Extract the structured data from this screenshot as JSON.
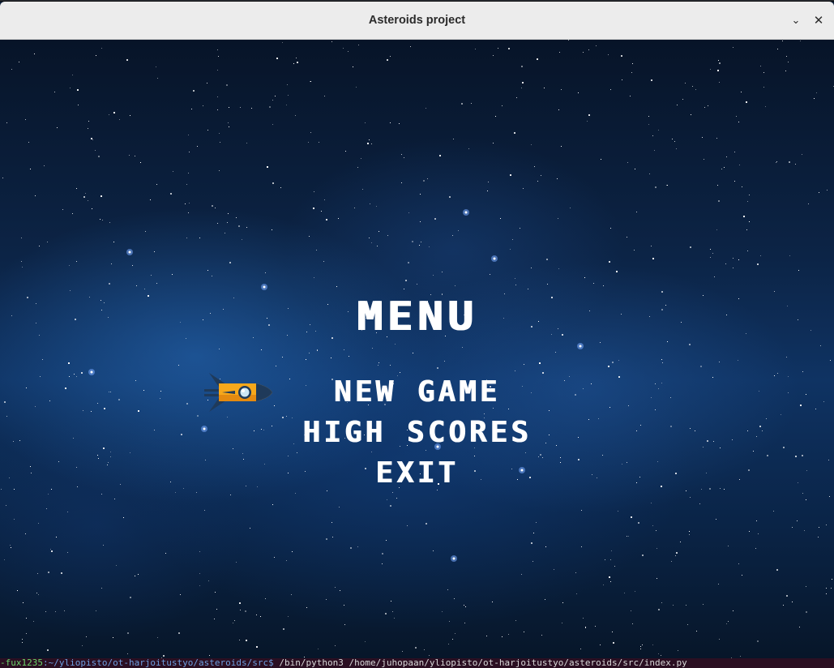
{
  "window": {
    "title": "Asteroids project",
    "minimize_icon": "chevron-down-icon",
    "close_icon": "close-icon"
  },
  "game": {
    "menu_title": "MENU",
    "items": [
      {
        "label": "NEW GAME",
        "selected": true
      },
      {
        "label": "HIGH SCORES",
        "selected": false
      },
      {
        "label": "EXIT",
        "selected": false
      }
    ],
    "cursor_icon": "rocket-icon"
  },
  "terminal": {
    "user": "-fux1235",
    "path": ":~/yliopisto/ot-harjoitustyo/asteroids/src$",
    "command": " /bin/python3 /home/juhopaan/yliopisto/ot-harjoitustyo/asteroids/src/index.py"
  },
  "colors": {
    "titlebar": "#ececec",
    "text": "#ffffff",
    "space_dark": "#071428",
    "space_mid": "#0f3363"
  }
}
